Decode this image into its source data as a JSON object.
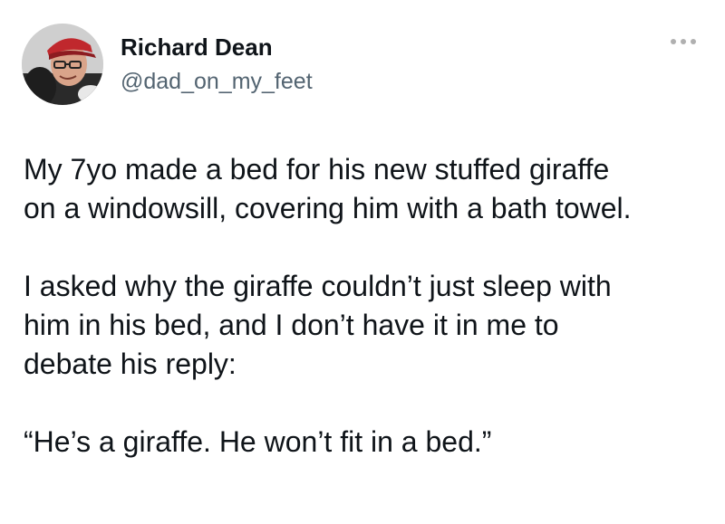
{
  "author": {
    "display_name": "Richard Dean",
    "handle": "@dad_on_my_feet",
    "avatar_icon": "profile-photo"
  },
  "menu": {
    "icon": "more-options-icon"
  },
  "tweet": {
    "paragraphs": [
      {
        "lines": [
          "My 7yo made a bed for his new stuffed giraffe",
          "on a windowsill, covering him with a bath towel."
        ]
      },
      {
        "lines": [
          "I asked why the giraffe couldn’t just sleep with",
          "him in his bed, and I don’t have it in me to",
          "debate his reply:"
        ]
      },
      {
        "lines": [
          "“He’s a giraffe.  He won’t fit in a bed.”"
        ]
      }
    ]
  },
  "colors": {
    "text": "#0f1419",
    "secondary_text": "#536471",
    "menu_dots": "#b0b0b0",
    "background": "#ffffff"
  }
}
